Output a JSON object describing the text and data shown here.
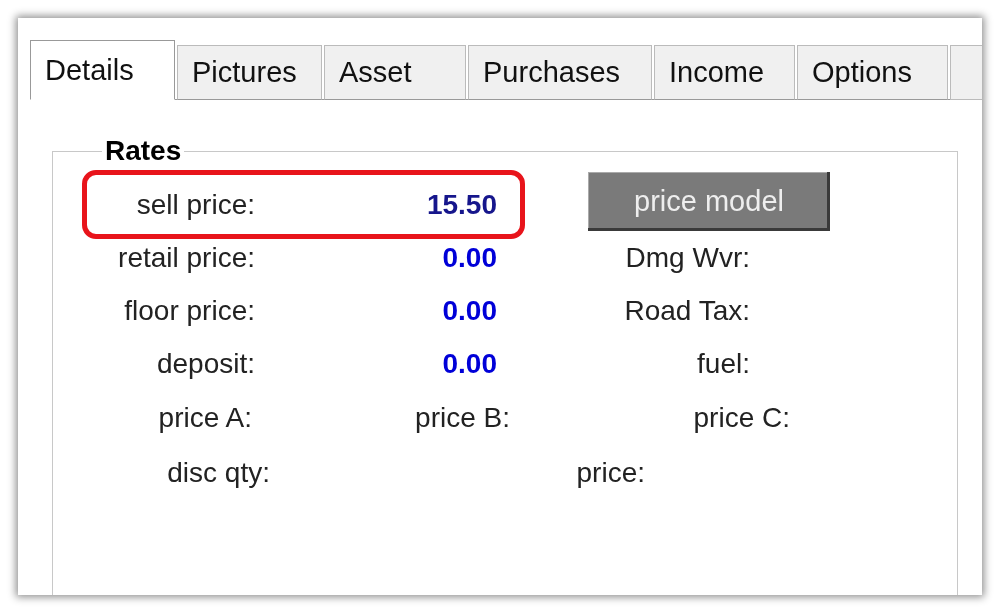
{
  "tabs": [
    {
      "label": "Details",
      "selected": true
    },
    {
      "label": "Pictures",
      "selected": false
    },
    {
      "label": "Asset",
      "selected": false
    },
    {
      "label": "Purchases",
      "selected": false
    },
    {
      "label": "Income",
      "selected": false
    },
    {
      "label": "Options",
      "selected": false
    }
  ],
  "rates": {
    "title": "Rates",
    "rows": [
      {
        "label": "sell price:",
        "value": "15.50",
        "highlighted": true
      },
      {
        "label": "retail price:",
        "value": "0.00",
        "highlighted": false
      },
      {
        "label": "floor price:",
        "value": "0.00",
        "highlighted": false
      },
      {
        "label": "deposit:",
        "value": "0.00",
        "highlighted": false
      }
    ],
    "button": {
      "label": "price model"
    },
    "side_fields": [
      "Dmg Wvr:",
      "Road Tax:",
      "fuel:"
    ],
    "price_levels": [
      "price A:",
      "price B:",
      "price C:"
    ],
    "discount": [
      "disc qty:",
      "price:"
    ]
  }
}
